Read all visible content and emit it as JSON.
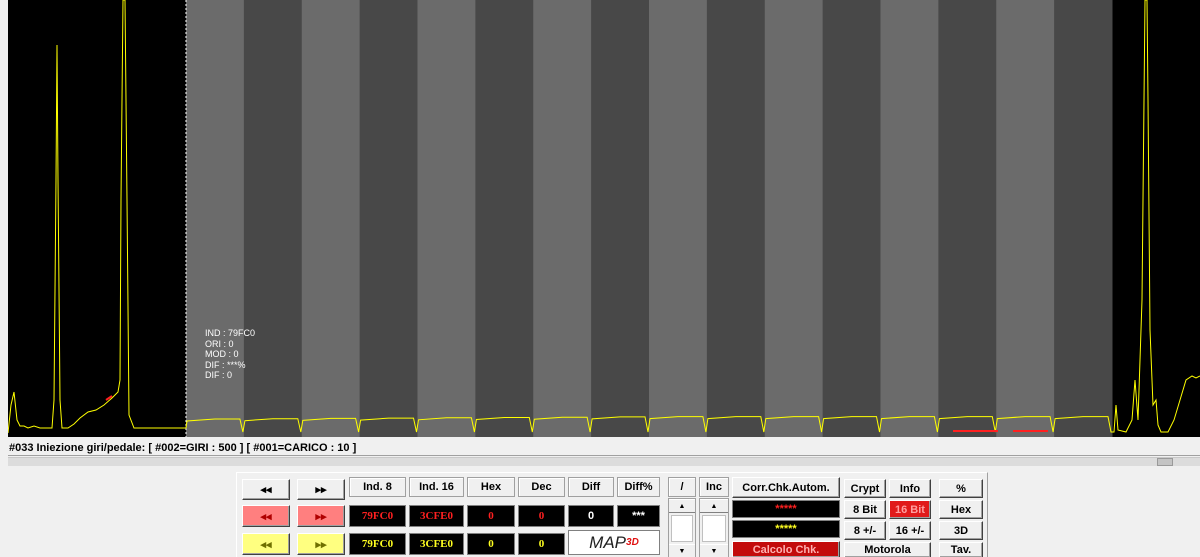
{
  "chart_data": {
    "type": "line",
    "series_color": "#ffff00",
    "marker_color": "#ff2020",
    "background": "#000000",
    "band_colors": [
      "#6b6b6b",
      "#484848"
    ],
    "band_count": 16
  },
  "info_overlay": {
    "lines": [
      "IND : 79FC0",
      "ORI : 0",
      "MOD : 0",
      "DIF : ***%",
      "DIF : 0"
    ]
  },
  "status": {
    "text": "#033 Iniezione giri/pedale:  [ #002=GIRI : 500 ]  [ #001=CARICO : 10 ]"
  },
  "panel": {
    "nav": {
      "rewind": "◂◂",
      "forward": "▸▸"
    },
    "headers": {
      "ind8": "Ind. 8",
      "ind16": "Ind. 16",
      "hex": "Hex",
      "dec": "Dec",
      "diff": "Diff",
      "diffpct": "Diff%"
    },
    "row_red": {
      "ind8": "79FC0",
      "ind16": "3CFE0",
      "hex": "0",
      "dec": "0",
      "diff": "0",
      "diffpct": "***"
    },
    "row_yellow": {
      "ind8": "79FC0",
      "ind16": "3CFE0",
      "hex": "0",
      "dec": "0"
    },
    "map3d": {
      "text": "MAP",
      "sub": "3D"
    },
    "slash": "/",
    "inc": "Inc",
    "corr": "Corr.Chk.Autom.",
    "chk_red": "*****",
    "chk_yellow": "*****",
    "calcolo": "Calcolo Chk.",
    "crypt": "Crypt",
    "info": "Info",
    "bit8": "8 Bit",
    "bit16": "16 Bit",
    "pm8": "8 +/-",
    "pm16": "16 +/-",
    "motorola": "Motorola",
    "pct": "%",
    "hexbtn": "Hex",
    "d3": "3D",
    "tav": "Tav."
  }
}
